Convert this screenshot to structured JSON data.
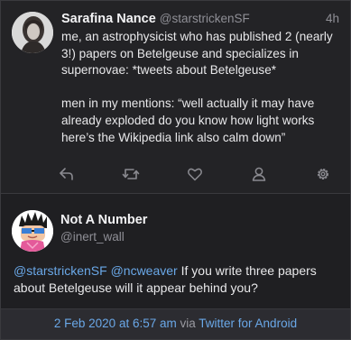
{
  "tweet": {
    "author_name": "Sarafina Nance",
    "author_handle": "@starstrickenSF",
    "time": "4h",
    "text_p1": "me, an astrophysicist who has published 2 (nearly 3!) papers on Betelgeuse and specializes in supernovae: *tweets about Betelgeuse*",
    "text_p2": "men in my mentions: “well actually it may have already exploded do you know how light works here’s the Wikipedia link also calm down”"
  },
  "reply": {
    "author_name": "Not A Number",
    "author_handle": "@inert_wall",
    "mention1": "@starstrickenSF",
    "mention2": "@ncweaver",
    "text": " If you write three papers about Betelgeuse will it appear behind you?",
    "date": "2 Feb 2020 at 6:57 am",
    "via_word": "via",
    "client": "Twitter for Android"
  },
  "colors": {
    "background": "#232326",
    "reply_background": "#1f1f22",
    "link": "#6aa8e8",
    "muted": "#8f8f96",
    "icon": "#8a8a90"
  },
  "icons": {
    "reply": "reply-arrow-icon",
    "retweet": "retweet-icon",
    "like": "heart-icon",
    "profile": "person-icon",
    "settings": "gear-icon"
  }
}
